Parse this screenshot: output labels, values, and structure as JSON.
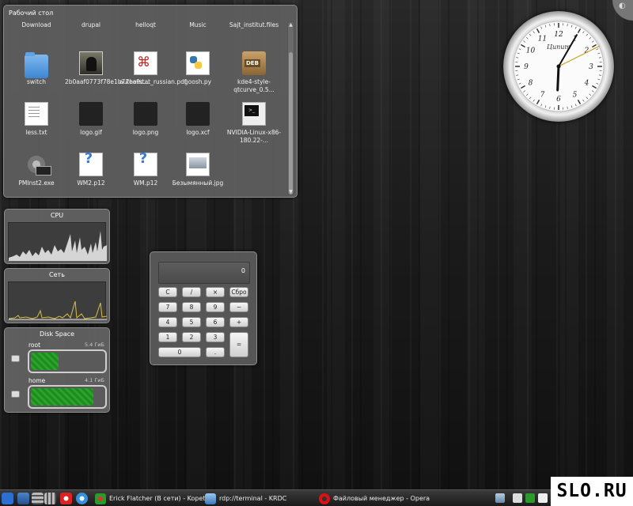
{
  "folderview": {
    "title": "Рабочий стол",
    "items": [
      {
        "label": "Download",
        "icon": "folder-icon"
      },
      {
        "label": "drupal",
        "icon": "folder-icon"
      },
      {
        "label": "helloqt",
        "icon": "folder-icon"
      },
      {
        "label": "Music",
        "icon": "folder-icon"
      },
      {
        "label": "Sajt_institut.files",
        "icon": "folder-icon"
      },
      {
        "label": "switch",
        "icon": "folder-icon"
      },
      {
        "label": "2b0aaf0773f78e1b77ea9c...",
        "icon": "photo-icon"
      },
      {
        "label": "authorstat_russian.pdf",
        "icon": "pdf-icon"
      },
      {
        "label": "goosh.py",
        "icon": "python-icon"
      },
      {
        "label": "kde4-style-qtcurve_0.5...",
        "icon": "deb-icon"
      },
      {
        "label": "less.txt",
        "icon": "text-icon"
      },
      {
        "label": "logo.gif",
        "icon": "image-icon"
      },
      {
        "label": "logo.png",
        "icon": "image-icon"
      },
      {
        "label": "logo.xcf",
        "icon": "image-icon"
      },
      {
        "label": "NVIDIA-Linux-x86-180.22-...",
        "icon": "terminal-icon"
      },
      {
        "label": "PMInst2.exe",
        "icon": "gear-icon"
      },
      {
        "label": "WM2.p12",
        "icon": "unknown-file-icon"
      },
      {
        "label": "WM.p12",
        "icon": "unknown-file-icon"
      },
      {
        "label": "Безымянный.jpg",
        "icon": "image-icon"
      }
    ]
  },
  "cpu": {
    "title": "CPU"
  },
  "net": {
    "title": "Сеть"
  },
  "disk": {
    "title": "Disk Space",
    "drives": [
      {
        "name": "root",
        "size": "5.4 ГиБ",
        "used": 0.38
      },
      {
        "name": "home",
        "size": "4.1 ГиБ",
        "used": 0.86
      }
    ]
  },
  "calculator": {
    "display": "0",
    "keys": [
      "C",
      "/",
      "×",
      "Сбро",
      "7",
      "8",
      "9",
      "−",
      "4",
      "5",
      "6",
      "+",
      "1",
      "2",
      "3",
      "=",
      "0",
      "."
    ]
  },
  "clock": {
    "brand": "Ципит",
    "time": "18:05"
  },
  "taskbar": {
    "tasks": [
      {
        "label": "Erick Flatcher (В сети) - Kopete",
        "icon": "kopete-icon"
      },
      {
        "label": "rdp://terminal - KRDC",
        "icon": "krdc-icon"
      },
      {
        "label": "Файловый менеджер - Opera",
        "icon": "opera-icon"
      }
    ]
  },
  "watermark": {
    "text": "SLO.RU"
  },
  "colors": {
    "accent": "#3d86d4",
    "cpu_graph": "#e6e6e6",
    "net_graph": "#d7c23a",
    "disk_fill": "#1f8a1f"
  }
}
